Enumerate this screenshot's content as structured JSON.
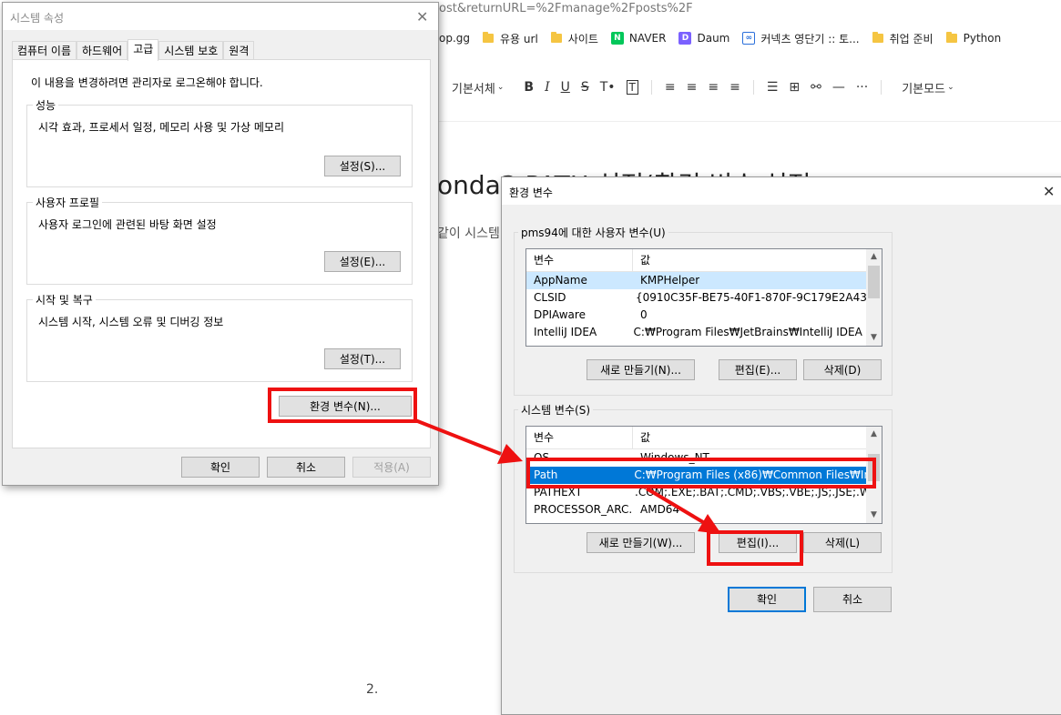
{
  "browser": {
    "url_fragment": "ost&returnURL=%2Fmanage%2Fposts%2F",
    "bookmarks": [
      {
        "label": "op.gg",
        "icon": "opgg-favicon"
      },
      {
        "label": "유용 url",
        "icon": "folder-icon"
      },
      {
        "label": "사이트",
        "icon": "folder-icon"
      },
      {
        "label": "NAVER",
        "icon": "naver-favicon"
      },
      {
        "label": "Daum",
        "icon": "daum-favicon"
      },
      {
        "label": "커넥츠 영단기 :: 토...",
        "icon": "conects-favicon"
      },
      {
        "label": "취업 준비",
        "icon": "folder-icon"
      },
      {
        "label": "Python",
        "icon": "folder-icon"
      }
    ]
  },
  "editor": {
    "font_select": "기본서체",
    "mode_select": "기본모드",
    "title_fragment": "onda3 PATH 설정(환경 변수 설정",
    "para_fragment": "같이 시스템",
    "footnote": "2."
  },
  "sys_props": {
    "title": "시스템 속성",
    "tabs": [
      "컴퓨터 이름",
      "하드웨어",
      "고급",
      "시스템 보호",
      "원격"
    ],
    "admin_note": "이 내용을 변경하려면 관리자로 로그온해야 합니다.",
    "perf_label": "성능",
    "perf_desc": "시각 효과, 프로세서 일정, 메모리 사용 및 가상 메모리",
    "perf_btn": "설정(S)...",
    "profile_label": "사용자 프로필",
    "profile_desc": "사용자 로그인에 관련된 바탕 화면 설정",
    "profile_btn": "설정(E)...",
    "startup_label": "시작 및 복구",
    "startup_desc": "시스템 시작, 시스템 오류 및 디버깅 정보",
    "startup_btn": "설정(T)...",
    "env_btn": "환경 변수(N)...",
    "ok": "확인",
    "cancel": "취소",
    "apply": "적용(A)"
  },
  "env_vars": {
    "title": "환경 변수",
    "user_group": "pms94에 대한 사용자 변수(U)",
    "col_var": "변수",
    "col_val": "값",
    "user_rows": [
      {
        "name": "AppName",
        "value": "KMPHelper"
      },
      {
        "name": "CLSID",
        "value": "{0910C35F-BE75-40F1-870F-9C179E2A43..."
      },
      {
        "name": "DPIAware",
        "value": "0"
      },
      {
        "name": "IntelliJ IDEA",
        "value": "C:₩Program Files₩JetBrains₩IntelliJ IDEA 2..."
      }
    ],
    "user_new": "새로 만들기(N)...",
    "user_edit": "편집(E)...",
    "user_delete": "삭제(D)",
    "sys_group": "시스템 변수(S)",
    "sys_rows": [
      {
        "name": "OS",
        "value": "Windows_NT"
      },
      {
        "name": "Path",
        "value": "C:₩Program Files (x86)₩Common Files₩In..."
      },
      {
        "name": "PATHEXT",
        "value": ".COM;.EXE;.BAT;.CMD;.VBS;.VBE;.JS;.JSE;.W..."
      },
      {
        "name": "PROCESSOR_ARC...",
        "value": "AMD64"
      }
    ],
    "sys_new": "새로 만들기(W)...",
    "sys_edit": "편집(I)...",
    "sys_delete": "삭제(L)",
    "ok": "확인",
    "cancel": "취소"
  },
  "colors": {
    "highlight_red": "#ee1111",
    "selection_blue": "#0078d7"
  }
}
